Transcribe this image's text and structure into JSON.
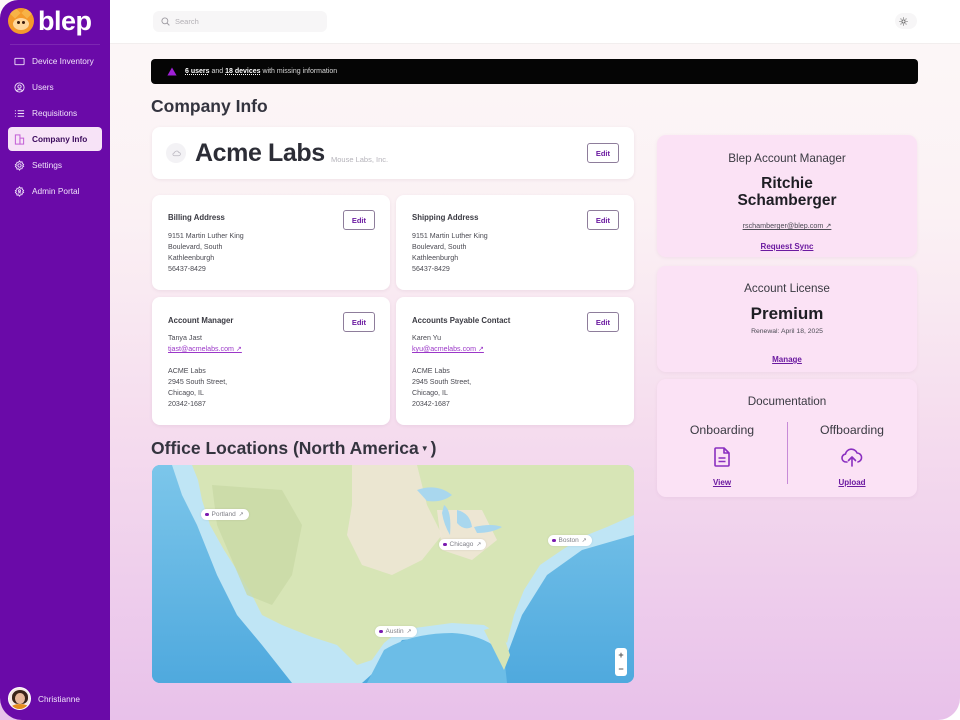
{
  "app": {
    "brand": "blep",
    "accent_color": "#6a0aa8",
    "link_color": "#6b1aa0"
  },
  "sidebar": {
    "items": [
      {
        "label": "Device Inventory",
        "icon": "laptop-icon",
        "active": false
      },
      {
        "label": "Users",
        "icon": "user-circle-icon",
        "active": false
      },
      {
        "label": "Requisitions",
        "icon": "list-icon",
        "active": false
      },
      {
        "label": "Company Info",
        "icon": "building-icon",
        "active": true
      },
      {
        "label": "Settings",
        "icon": "gear-icon",
        "active": false
      },
      {
        "label": "Admin Portal",
        "icon": "admin-gear-icon",
        "active": false
      }
    ],
    "user": {
      "name": "Christianne"
    }
  },
  "topbar": {
    "search_placeholder": "Search",
    "theme_icon": "sun-icon"
  },
  "alert": {
    "users_count": "6 users",
    "connector": "and",
    "devices_count": "18 devices",
    "suffix": "with missing information"
  },
  "page": {
    "title": "Company Info"
  },
  "company": {
    "name": "Acme Labs",
    "legal_name": "Mouse Labs, Inc.",
    "edit_label": "Edit"
  },
  "cards": {
    "billing": {
      "title": "Billing Address",
      "lines": [
        "9151 Martin Luther King",
        "Boulevard, South",
        "Kathleenburgh",
        "56437-8429"
      ],
      "edit_label": "Edit"
    },
    "shipping": {
      "title": "Shipping Address",
      "lines": [
        "9151 Martin Luther King",
        "Boulevard, South",
        "Kathleenburgh",
        "56437-8429"
      ],
      "edit_label": "Edit"
    },
    "account_manager": {
      "title": "Account Manager",
      "name": "Tanya Jast",
      "email": "tjast@acmelabs.com ↗",
      "address": [
        "ACME Labs",
        "2945 South Street,",
        "Chicago, IL",
        "20342-1687"
      ],
      "edit_label": "Edit"
    },
    "ap_contact": {
      "title": "Accounts Payable Contact",
      "name": "Karen Yu",
      "email": "kyu@acmelabs.com ↗",
      "address": [
        "ACME Labs",
        "2945 South Street,",
        "Chicago, IL",
        "20342-1687"
      ],
      "edit_label": "Edit"
    }
  },
  "offices": {
    "title": "Office Locations (North America",
    "title_close": ")",
    "region_selected": "North America",
    "pins": [
      {
        "label": "Portland"
      },
      {
        "label": "Chicago"
      },
      {
        "label": "Boston"
      },
      {
        "label": "Austin"
      }
    ],
    "zoom_in": "+",
    "zoom_out": "−"
  },
  "blep_manager": {
    "title": "Blep Account Manager",
    "first_name": "Ritchie",
    "last_name": "Schamberger",
    "email": "rschamberger@blep.com ↗",
    "action": "Request Sync"
  },
  "license": {
    "title": "Account License",
    "tier": "Premium",
    "renewal": "Renewal: April 18, 2025",
    "action": "Manage"
  },
  "documentation": {
    "title": "Documentation",
    "onboarding": {
      "title": "Onboarding",
      "icon": "document-icon",
      "action": "View"
    },
    "offboarding": {
      "title": "Offboarding",
      "icon": "cloud-upload-icon",
      "action": "Upload"
    }
  }
}
